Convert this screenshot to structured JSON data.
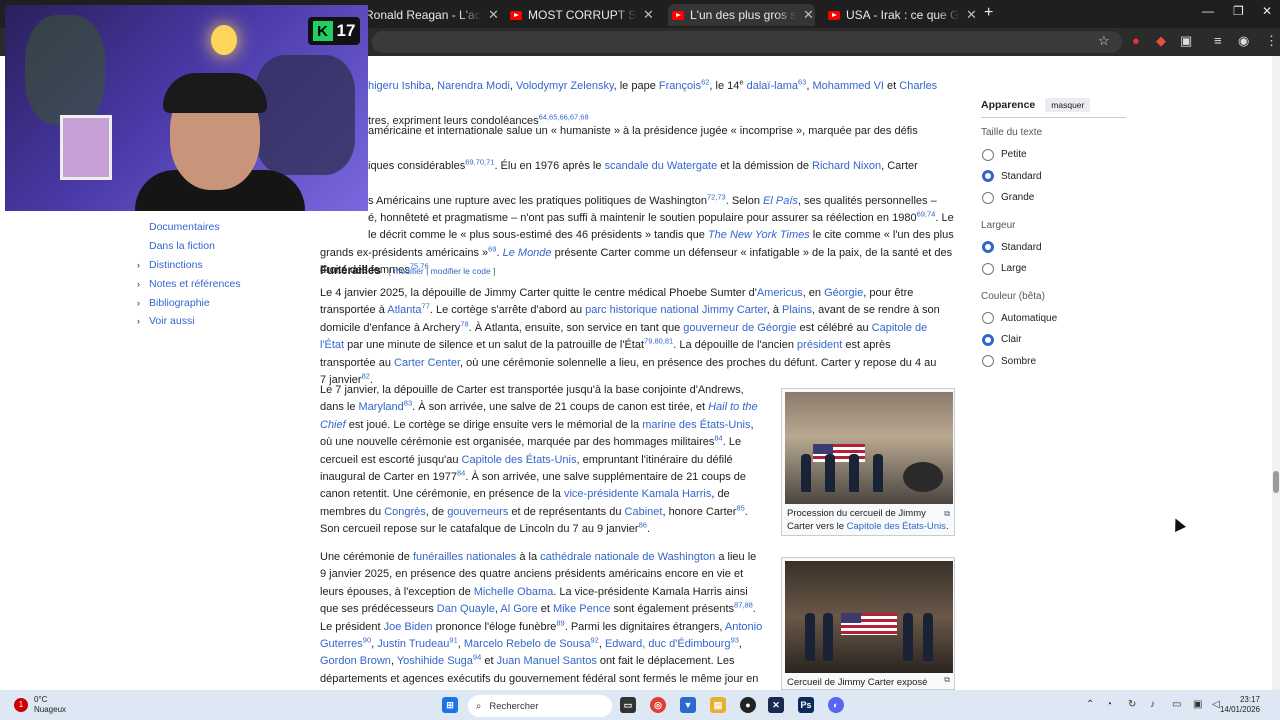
{
  "browser": {
    "tabs": [
      {
        "title": "Ronald Reagan - L'acteur Holly"
      },
      {
        "title": "MOST CORRUPT SERIES: Presid"
      },
      {
        "title": "L'un des plus gros scandale de"
      },
      {
        "title": "USA - Irak : ce que George W B"
      }
    ],
    "new_tab": "+",
    "window_controls": {
      "minimize": "—",
      "maximize": "❐",
      "close": "✕"
    }
  },
  "stream": {
    "badge_letter": "K",
    "badge_count": "17"
  },
  "sidebar": {
    "items": [
      {
        "label": "Documentaires",
        "chevron": ""
      },
      {
        "label": "Dans la fiction",
        "chevron": ""
      },
      {
        "label": "Distinctions",
        "chevron": "›"
      },
      {
        "label": "Notes et références",
        "chevron": "›"
      },
      {
        "label": "Bibliographie",
        "chevron": "›"
      },
      {
        "label": "Voir aussi",
        "chevron": "›"
      }
    ]
  },
  "article": {
    "top": {
      "line1_link1": "higeru Ishiba",
      "line1_sep1": ", ",
      "line1_link2": "Narendra Modi",
      "line1_sep2": ", ",
      "line1_link3": "Volodymyr Zelensky",
      "line1_t1": ", le pape ",
      "line1_link4": "François",
      "line1_sup1": "62",
      "line1_t2": ", le 14",
      "line1_sup_e": "e",
      "line1_link5": "dalaï-lama",
      "line1_sup2": "63",
      "line1_t3": ", ",
      "line1_link6": "Mohammed VI",
      "line1_t4": " et ",
      "line1_link7": "Charles III",
      "line1_t5": ",",
      "line2_text": "tres, expriment leurs condoléances",
      "line2_sup": "64,65,66,67,68"
    },
    "intro": {
      "t1": "américaine et internationale salue un « humaniste » à la présidence jugée « incomprise », marquée par des défis politiques",
      "t2": "iques considérables",
      "sup1": "69,70,71",
      "t3": ". Élu en 1976 après le ",
      "link1": "scandale du Watergate",
      "t4": " et la démission de ",
      "link2": "Richard Nixon",
      "t5": ", Carter incarne",
      "t6": "s Américains une rupture avec les pratiques politiques de Washington",
      "sup2": "72,73",
      "t7": ". Selon ",
      "link3": "El País",
      "t8": ", ses qualités personnelles –",
      "t9": "é, honnêteté et pragmatisme – n'ont pas suffi à maintenir le soutien populaire pour assurer sa réélection en 1980",
      "sup3": "69,74",
      "t10": ". Le",
      "t11": "le décrit comme le « plus sous-estimé des 46 présidents » tandis que ",
      "link4": "The New York Times",
      "t12": " le cite comme « l'un des plus",
      "t13": "grands ex-présidents américains »",
      "sup4": "69",
      "t14": ". ",
      "link5": "Le Monde",
      "t15": " présente Carter comme un défenseur « infatigable » de la paix, de la santé et des",
      "t16": "droits des femmes",
      "sup5": "75,76"
    },
    "section_title": "Funérailles",
    "edit_links": {
      "open": "[",
      "edit": "modifier",
      "sep": "|",
      "edit_code": "modifier le code",
      "close": "]"
    },
    "p1": {
      "t1": "Le 4 janvier 2025, la dépouille de Jimmy Carter quitte le centre médical Phoebe Sumter d'",
      "l1": "Americus",
      "t2": ", en ",
      "l2": "Géorgie",
      "t3": ", pour être transportée à ",
      "l3": "Atlanta",
      "s1": "77",
      "t4": ". Le cortège s'arrête d'abord au ",
      "l4": "parc historique national Jimmy Carter",
      "t5": ", à ",
      "l5": "Plains",
      "t6": ", avant de se rendre à son domicile d'enfance à Archery",
      "s2": "78",
      "t7": ". À Atlanta, ensuite, son service en tant que ",
      "l6": "gouverneur de Géorgie",
      "t8": " est célébré au ",
      "l7": "Capitole de l'État",
      "t9": " par une minute de silence et un salut de la patrouille de l'État",
      "s3": "79,80,81",
      "t10": ". La dépouille de l'ancien ",
      "l8": "président",
      "t11": " est après transportée au ",
      "l9": "Carter Center",
      "t12": ", où une cérémonie solennelle a lieu, en présence des proches du défunt. Carter y repose du 4 au 7 janvier",
      "s4": "82",
      "t13": "."
    },
    "p2": {
      "t1": "Le 7 janvier, la dépouille de Carter est transportée jusqu'à la base conjointe d'Andrews, dans le ",
      "l1": "Maryland",
      "s1": "83",
      "t2": ". À son arrivée, une salve de 21 coups de canon est tirée, et ",
      "l2": "Hail to the Chief",
      "t3": " est joué. Le cortège se dirige ensuite vers le mémorial de la ",
      "l3": "marine des États-Unis",
      "t4": ", où une nouvelle cérémonie est organisée, marquée par des hommages militaires",
      "s2": "84",
      "t5": ". Le cercueil est escorté jusqu'au ",
      "l4": "Capitole des États-Unis",
      "t6": ", empruntant l'itinéraire du défilé inaugural de Carter en 1977",
      "s3": "84",
      "t7": ". À son arrivée, une salve supplémentaire de 21 coups de canon retentit. Une cérémonie, en présence de la ",
      "l5": "vice-présidente Kamala Harris",
      "t8": ", de membres du ",
      "l6": "Congrès",
      "t9": ", de ",
      "l7": "gouverneurs",
      "t10": " et de représentants du ",
      "l8": "Cabinet",
      "t11": ", honore Carter",
      "s4": "85",
      "t12": ". Son cercueil repose sur le catafalque de Lincoln du 7 au 9 janvier",
      "s5": "86",
      "t13": "."
    },
    "p3": {
      "t1": "Une cérémonie de ",
      "l1": "funérailles nationales",
      "t2": " à la ",
      "l2": "cathédrale nationale de Washington",
      "t3": " a lieu le 9 janvier 2025, en présence des quatre anciens présidents américains encore en vie et leurs épouses, à l'exception de ",
      "l3": "Michelle Obama",
      "t4": ". La vice-présidente Kamala Harris ainsi que ses prédécesseurs ",
      "l4": "Dan Quayle",
      "t5": ", ",
      "l5": "Al Gore",
      "t6": " et ",
      "l6": "Mike Pence",
      "t7": " sont également présents",
      "s1": "87,88",
      "t8": ". Le président ",
      "l7": "Joe Biden",
      "t9": " prononce l'éloge funèbre",
      "s2": "89",
      "t10": ". Parmi les dignitaires étrangers, ",
      "l8": "Antonio Guterres",
      "s3": "90",
      "t11": ", ",
      "l9": "Justin Trudeau",
      "s4": "91",
      "t12": ", ",
      "l10": "Marcelo Rebelo de Sousa",
      "s5": "92",
      "t13": ", ",
      "l11": "Edward, duc d'Édimbourg",
      "s6": "93",
      "t14": ", ",
      "l12": "Gordon Brown",
      "t15": ", ",
      "l13": "Yoshihide Suga",
      "s7": "94",
      "t16": " et ",
      "l14": "Juan Manuel Santos",
      "t17": " ont fait le déplacement. Les départements et agences exécutifs du gouvernement fédéral sont fermés le même jour en"
    },
    "thumb1": {
      "caption_text": "Procession du cercueil de Jimmy Carter vers le ",
      "caption_link": "Capitole des États-Unis",
      "caption_end": "."
    },
    "thumb2": {
      "caption_text": "Cercueil de Jimmy Carter exposé"
    }
  },
  "appearance": {
    "title": "Apparence",
    "hide_button": "masquer",
    "groups": [
      {
        "label": "Taille du texte",
        "options": [
          {
            "label": "Petite",
            "selected": false
          },
          {
            "label": "Standard",
            "selected": true
          },
          {
            "label": "Grande",
            "selected": false
          }
        ]
      },
      {
        "label": "Largeur",
        "options": [
          {
            "label": "Standard",
            "selected": true
          },
          {
            "label": "Large",
            "selected": false
          }
        ]
      },
      {
        "label": "Couleur (bêta)",
        "options": [
          {
            "label": "Automatique",
            "selected": false
          },
          {
            "label": "Clair",
            "selected": true
          },
          {
            "label": "Sombre",
            "selected": false
          }
        ]
      }
    ]
  },
  "taskbar": {
    "weather_temp": "0°C",
    "weather_desc": "Nuageux",
    "weather_badge": "1",
    "search_placeholder": "Rechercher",
    "time": "23:17",
    "date": "14/01/2026"
  },
  "colors": {
    "link": "#3366cc",
    "radio_selected": "#3366cc",
    "tabbar": "#1f1f1f"
  }
}
